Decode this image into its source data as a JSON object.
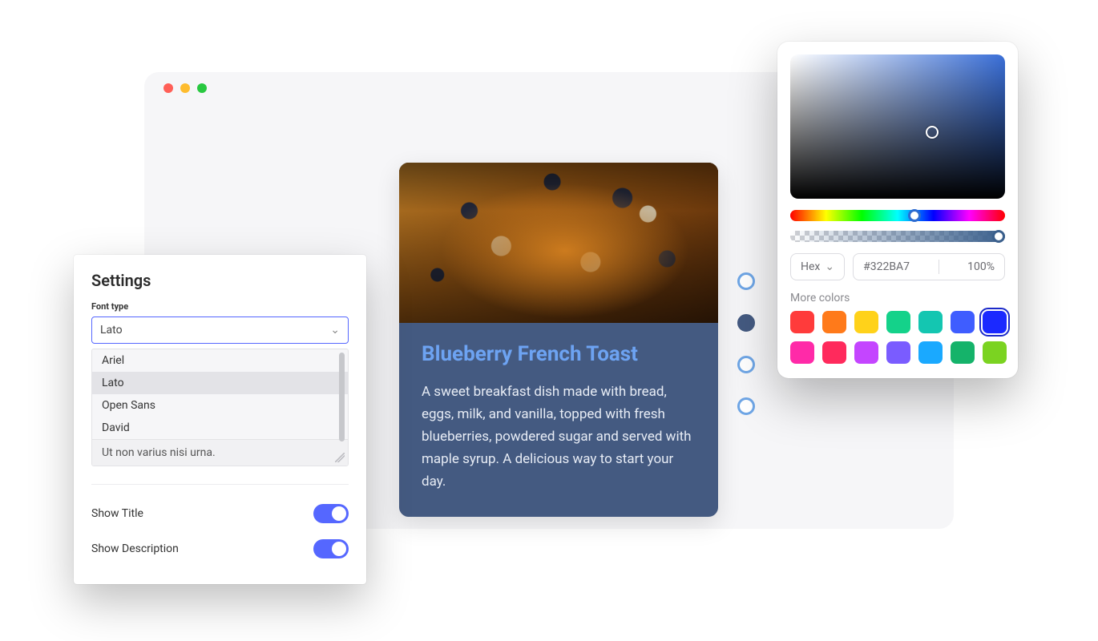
{
  "browser": {
    "traffic": [
      "red",
      "yellow",
      "green"
    ]
  },
  "card": {
    "title": "Blueberry French Toast",
    "description": "A sweet breakfast dish made with bread, eggs, milk, and vanilla, topped with fresh blueberries, powdered sugar and served with maple syrup. A delicious way to start your day."
  },
  "dots": {
    "count": 4,
    "active_index": 1
  },
  "settings": {
    "title": "Settings",
    "font_type_label": "Font type",
    "selected_font": "Lato",
    "options": [
      "Ariel",
      "Lato",
      "Open Sans",
      "David"
    ],
    "selected_option_index": 1,
    "sample_text": "Ut non varius nisi urna.",
    "toggles": {
      "show_title": {
        "label": "Show Title",
        "on": true
      },
      "show_description": {
        "label": "Show Description",
        "on": true
      }
    }
  },
  "picker": {
    "format_label": "Hex",
    "hex": "#322BA7",
    "alpha_text": "100%",
    "more_label": "More colors",
    "swatches": [
      "#ff3b3b",
      "#ff7a1a",
      "#ffd21a",
      "#14d28a",
      "#14c6b1",
      "#3f5dff",
      "#1b29ff",
      "#ff2aa8",
      "#ff2a5c",
      "#c445ff",
      "#7a5cff",
      "#1aa9ff",
      "#15b36a",
      "#7bd321"
    ],
    "selected_swatch_index": 6
  }
}
